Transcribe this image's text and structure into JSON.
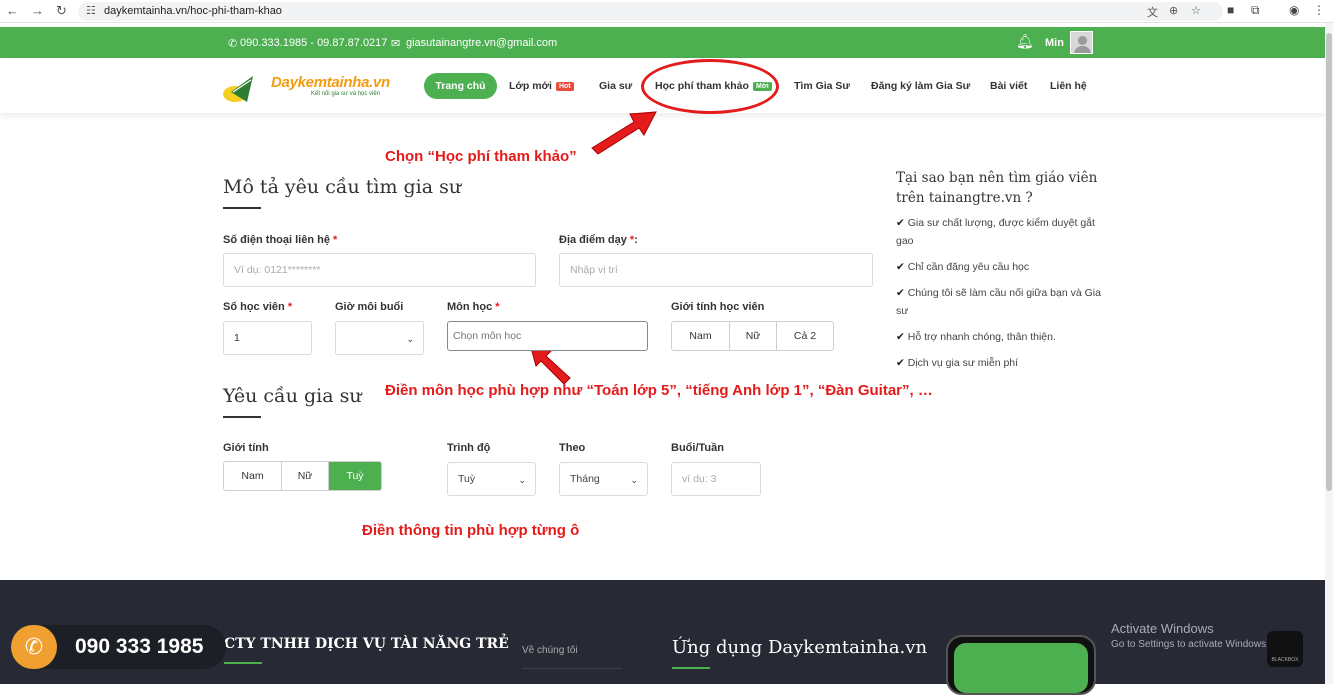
{
  "browser": {
    "url": "daykemtainha.vn/hoc-phi-tham-khao",
    "back_icon": "←",
    "forward_icon": "→",
    "reload_icon": "↻"
  },
  "topbar": {
    "phones": "090.333.1985 - 09.87.87.0217",
    "email": "giasutainangtre.vn@gmail.com",
    "user": "Min"
  },
  "logo": {
    "brand": "Daykemtainha.vn",
    "tagline": "Kết nối gia sư và học viên"
  },
  "nav": {
    "home": "Trang chủ",
    "new_classes": "Lớp mới",
    "hot_badge": "Hot",
    "tutors": "Gia sư",
    "fees": "Học phí tham khảo",
    "new_badge": "Mới",
    "find_tutor": "Tìm Gia Sư",
    "register_tutor": "Đăng ký làm Gia Sư",
    "articles": "Bài viết",
    "contact": "Liên hệ"
  },
  "annotations": {
    "choose_fees": "Chọn “Học phí tham khảo”",
    "subject_hint": "Điền môn học phù hợp như “Toán lớp 5”, “tiếng Anh lớp 1”, “Đàn Guitar”, …",
    "fill_hint": "Điền thông tin phù hợp từng ô"
  },
  "form": {
    "title": "Mô tả yêu cầu tìm gia sư",
    "phone_label": "Số điện thoại liên hệ",
    "phone_placeholder": "Ví dụ: 0121********",
    "location_label": "Địa điểm dạy",
    "location_placeholder": "Nhập vị trí",
    "students_label": "Số học viên",
    "students_value": "1",
    "hours_label": "Giờ môi buổi",
    "subject_label": "Môn học",
    "subject_placeholder": "Chọn môn học",
    "gender_student_label": "Giới tính học viên",
    "gender_student_options": [
      "Nam",
      "Nữ",
      "Cả 2"
    ],
    "req_star": "*",
    "colon": ":"
  },
  "tutor_req": {
    "title": "Yêu cầu gia sư",
    "gender_label": "Giới tính",
    "gender_options": [
      "Nam",
      "Nữ",
      "Tuỳ"
    ],
    "gender_selected": "Tuỳ",
    "level_label": "Trình độ",
    "level_value": "Tuỳ",
    "by_label": "Theo",
    "by_value": "Tháng",
    "sessions_label": "Buổi/Tuần",
    "sessions_placeholder": "ví dụ: 3"
  },
  "sidebar": {
    "title": "Tại sao bạn nên tìm giáo viên trên tainangtre.vn ?",
    "items": [
      "Gia sư chất lượng, được kiểm duyệt gắt gao",
      "Chỉ cần đăng yêu cầu học",
      "Chúng tôi sẽ làm cầu nối giữa bạn và Gia sư",
      "Hỗ trợ nhanh chóng, thân thiện.",
      "Dịch vụ gia sư miễn phí"
    ]
  },
  "footer": {
    "hotline": "090 333 1985",
    "company": "CTY TNHH DỊCH VỤ TÀI NĂNG TRẺ",
    "links": [
      "Về chúng tôi"
    ],
    "app_title": "Ứng dụng Daykemtainha.vn"
  },
  "overlay": {
    "activate_title": "Activate Windows",
    "activate_sub": "Go to Settings to activate Windows.",
    "blackbox": "BLACKBOX"
  },
  "colors": {
    "accent": "#4caf50",
    "annotation": "#e31b1b",
    "footer": "#272a34"
  }
}
